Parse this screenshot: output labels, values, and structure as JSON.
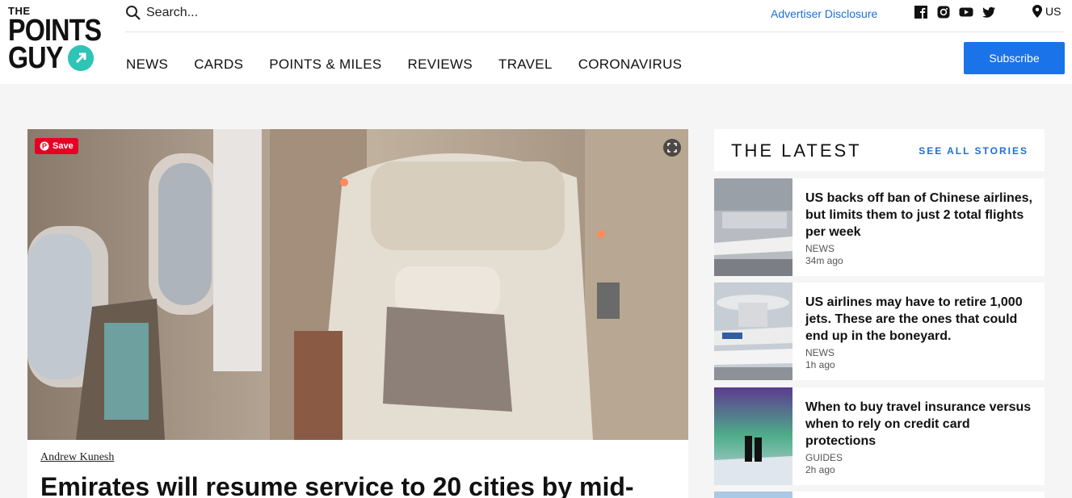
{
  "logo": {
    "line1": "THE",
    "line2": "POINTS",
    "line3": "GUY"
  },
  "search": {
    "placeholder": "Search..."
  },
  "header": {
    "advertiser_disclosure": "Advertiser Disclosure",
    "region": "US",
    "subscribe_label": "Subscribe",
    "social_icons": [
      "facebook-icon",
      "instagram-icon",
      "youtube-icon",
      "twitter-icon"
    ]
  },
  "nav": {
    "items": [
      "NEWS",
      "CARDS",
      "POINTS & MILES",
      "REVIEWS",
      "TRAVEL",
      "CORONAVIRUS"
    ]
  },
  "hero": {
    "save_label": "Save"
  },
  "article": {
    "author": "Andrew Kunesh",
    "headline": "Emirates will resume service to 20 cities by mid-"
  },
  "latest": {
    "title": "THE LATEST",
    "see_all": "SEE ALL STORIES",
    "stories": [
      {
        "title": "US backs off ban of Chinese airlines, but limits them to just 2 total flights per week",
        "category": "NEWS",
        "time": "34m ago"
      },
      {
        "title": "US airlines may have to retire 1,000 jets. These are the ones that could end up in the boneyard.",
        "category": "NEWS",
        "time": "1h ago"
      },
      {
        "title": "When to buy travel insurance versus when to rely on credit card protections",
        "category": "GUIDES",
        "time": "2h ago"
      }
    ]
  },
  "colors": {
    "accent": "#1a73e8",
    "link": "#1f6fd6",
    "pinterest": "#e60023",
    "logo_teal": "#2ec4b6"
  }
}
